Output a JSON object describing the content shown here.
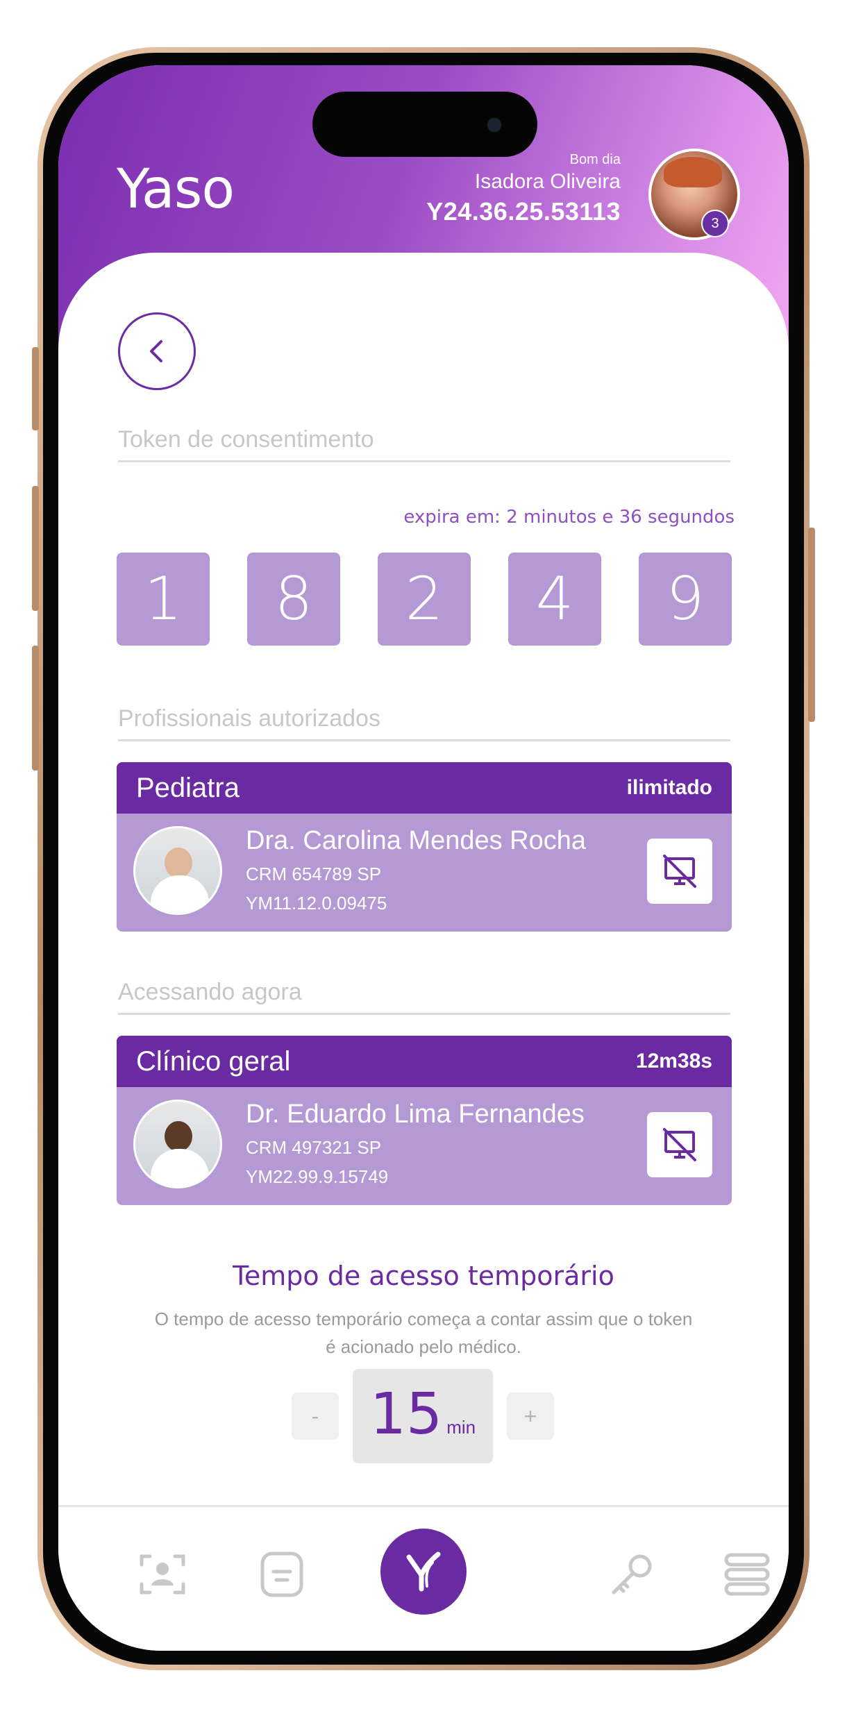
{
  "header": {
    "logo": "Yaso",
    "greeting": "Bom dia",
    "user_name": "Isadora Oliveira",
    "user_id": "Y24.36.25.53113",
    "notification_count": "3"
  },
  "token": {
    "label": "Token de consentimento",
    "expires": "expira em: 2 minutos e 36 segundos",
    "digits": [
      "1",
      "8",
      "2",
      "4",
      "9"
    ]
  },
  "authorized": {
    "label": "Profissionais autorizados",
    "specialty": "Pediatra",
    "duration": "ilimitado",
    "name": "Dra. Carolina Mendes Rocha",
    "crm": "CRM 654789 SP",
    "ym": "YM11.12.0.09475"
  },
  "accessing": {
    "label": "Acessando agora",
    "specialty": "Clínico geral",
    "duration": "12m38s",
    "name": "Dr. Eduardo Lima Fernandes",
    "crm": "CRM 497321 SP",
    "ym": "YM22.99.9.15749"
  },
  "temp_access": {
    "title": "Tempo de acesso temporário",
    "description": "O tempo de acesso temporário começa a contar assim que o token é acionado pelo médico.",
    "minus": "-",
    "plus": "+",
    "value": "15",
    "unit": "min"
  },
  "nav": {
    "icons": [
      "face-scan-icon",
      "document-icon",
      "yaso-home-icon",
      "key-icon",
      "menu-icon"
    ]
  },
  "colors": {
    "primary": "#6a2aa1",
    "tile": "#b599d4",
    "header_start": "#7a2db0",
    "header_end": "#f4a9f2"
  }
}
